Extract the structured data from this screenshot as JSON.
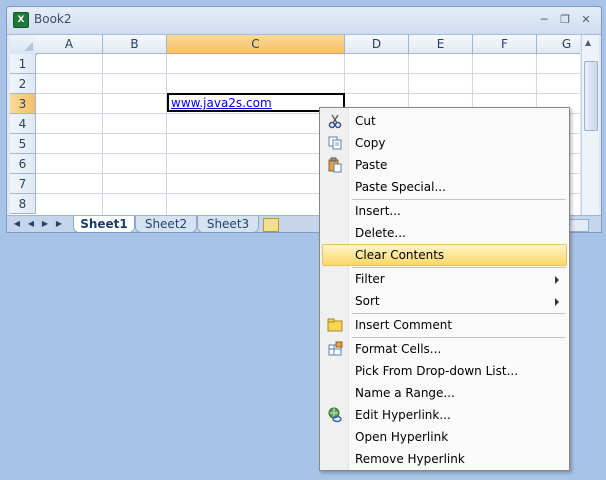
{
  "window": {
    "title": "Book2",
    "app_icon": "excel-icon"
  },
  "grid": {
    "columns": [
      "A",
      "B",
      "C",
      "D",
      "E",
      "F",
      "G"
    ],
    "rows": [
      "1",
      "2",
      "3",
      "4",
      "5",
      "6",
      "7",
      "8"
    ],
    "active_column": "C",
    "active_row": "3",
    "cell_c3_value": "www.java2s.com"
  },
  "sheets": {
    "tabs": [
      "Sheet1",
      "Sheet2",
      "Sheet3"
    ],
    "active": "Sheet1"
  },
  "context_menu": {
    "items": [
      {
        "label": "Cut",
        "icon": "scissors-icon"
      },
      {
        "label": "Copy",
        "icon": "copy-icon"
      },
      {
        "label": "Paste",
        "icon": "paste-icon"
      },
      {
        "label": "Paste Special...",
        "icon": ""
      },
      {
        "label": "Insert...",
        "icon": ""
      },
      {
        "label": "Delete...",
        "icon": ""
      },
      {
        "label": "Clear Contents",
        "icon": "",
        "highlighted": true
      },
      {
        "label": "Filter",
        "icon": "",
        "submenu": true
      },
      {
        "label": "Sort",
        "icon": "",
        "submenu": true
      },
      {
        "label": "Insert Comment",
        "icon": "comment-icon"
      },
      {
        "label": "Format Cells...",
        "icon": "format-cells-icon"
      },
      {
        "label": "Pick From Drop-down List...",
        "icon": ""
      },
      {
        "label": "Name a Range...",
        "icon": ""
      },
      {
        "label": "Edit Hyperlink...",
        "icon": "hyperlink-icon"
      },
      {
        "label": "Open Hyperlink",
        "icon": ""
      },
      {
        "label": "Remove Hyperlink",
        "icon": ""
      }
    ]
  },
  "colors": {
    "highlight": "#fbd865",
    "active_header": "#f4c068",
    "link": "#0000ee"
  }
}
